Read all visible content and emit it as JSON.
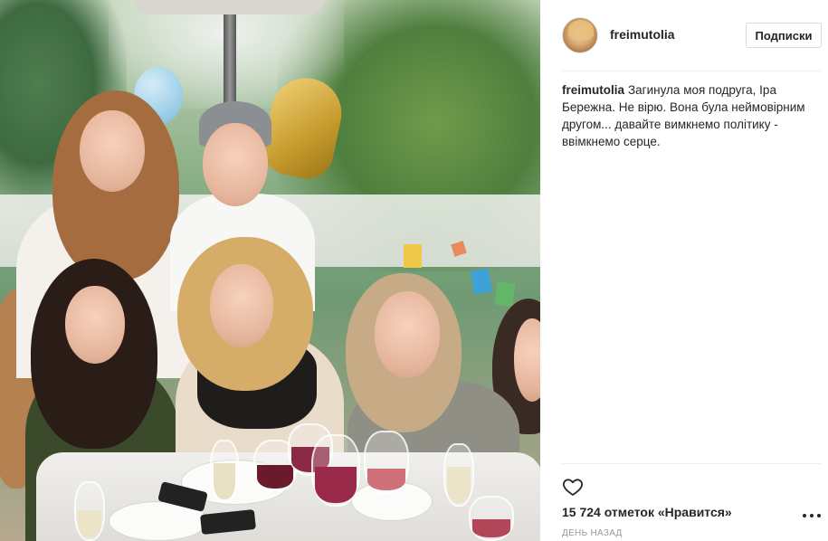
{
  "post": {
    "username": "freimutolia",
    "follow_button_label": "Подписки",
    "caption_author": "freimutolia",
    "caption_text": "Загинула моя подруга, Іра Бережна. Не вірю. Вона була неймовірним другом... давайте вимкнемо політику - ввімкнемо серце.",
    "likes_text": "15 724 отметок «Нравится»",
    "time_text": "ДЕНЬ НАЗАД"
  },
  "icons": {
    "avatar": "avatar",
    "like": "heart-icon",
    "more": "more-options-icon"
  },
  "colors": {
    "text": "#262626",
    "muted": "#999999",
    "border": "#dbdbdb",
    "divider": "#efefef"
  }
}
